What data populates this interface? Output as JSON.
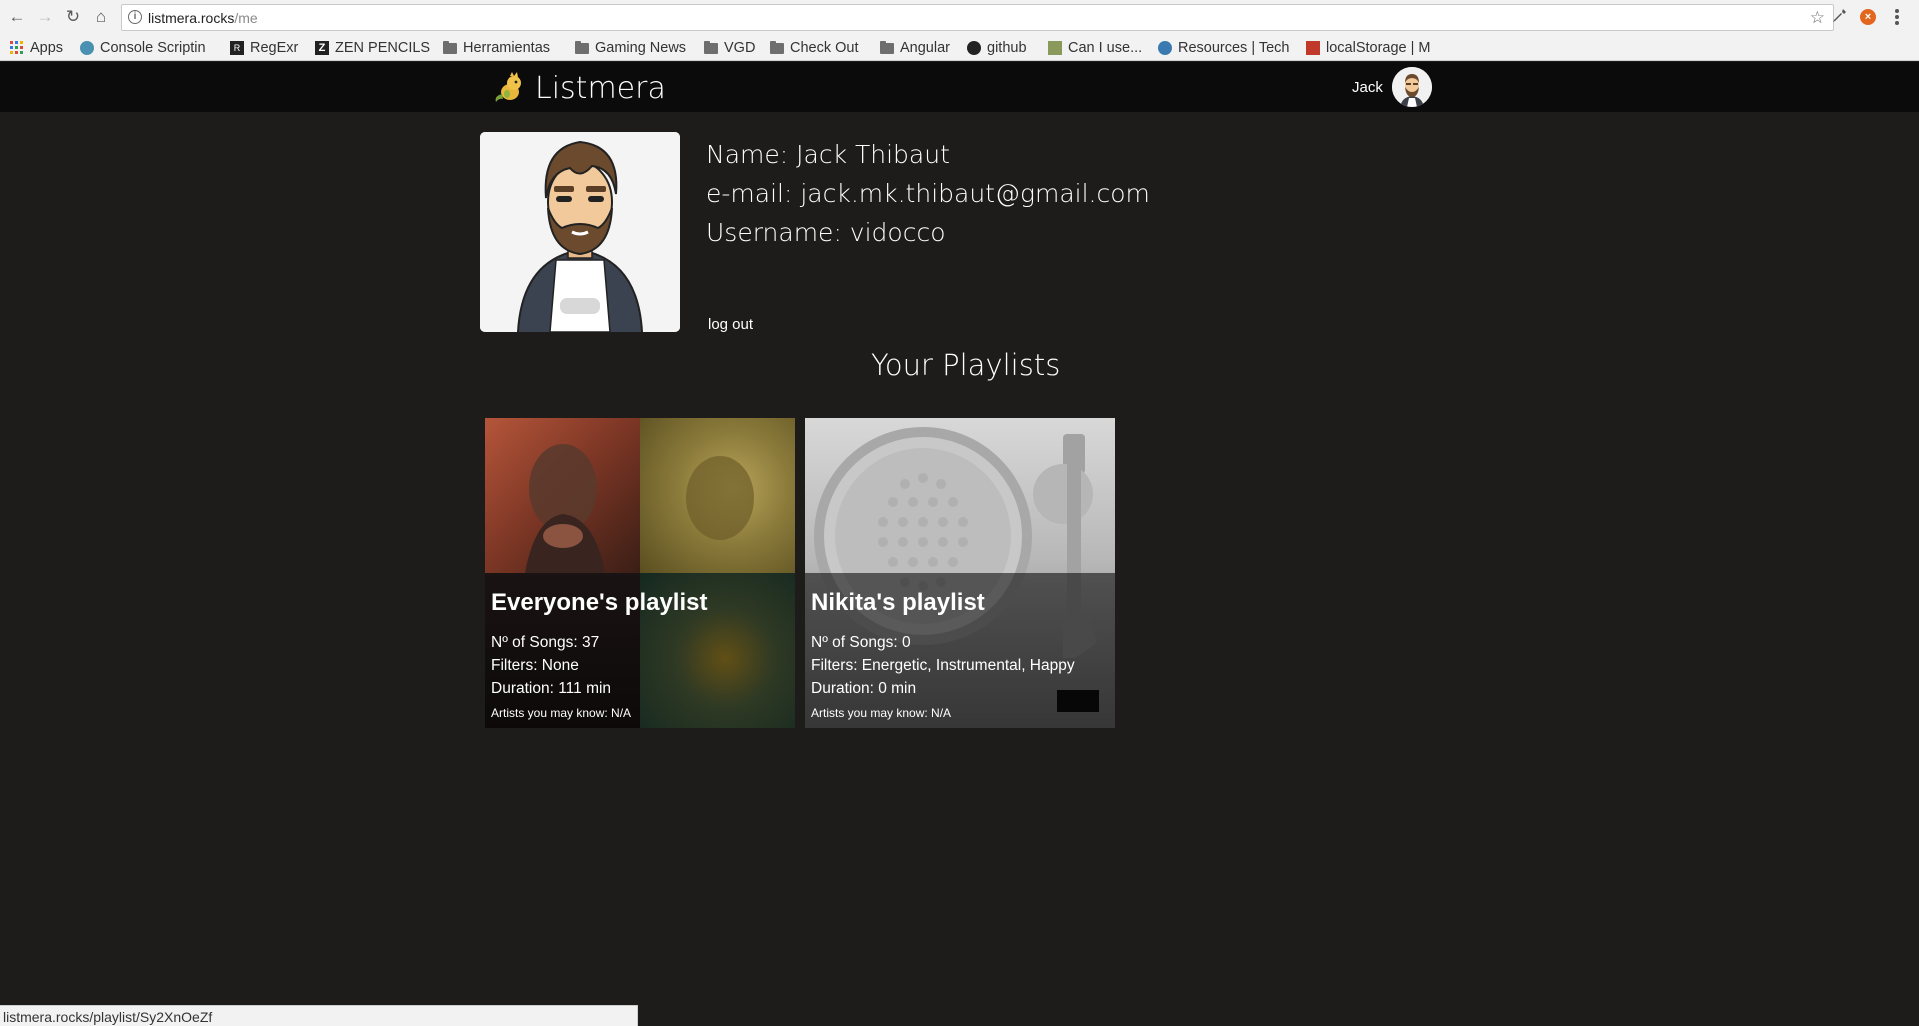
{
  "browser": {
    "url_host": "listmera.rocks",
    "url_path": "/me",
    "bookmarks": [
      {
        "label": "Apps",
        "icon": "apps-grid-icon"
      },
      {
        "label": "Console Scriptin",
        "icon": "globe-icon"
      },
      {
        "label": "RegExr",
        "icon": "regexr-icon"
      },
      {
        "label": "ZEN PENCILS",
        "icon": "zen-pencils-icon"
      },
      {
        "label": "Herramientas",
        "icon": "folder-icon"
      },
      {
        "label": "Gaming News",
        "icon": "folder-icon"
      },
      {
        "label": "VGD",
        "icon": "folder-icon"
      },
      {
        "label": "Check Out",
        "icon": "folder-icon"
      },
      {
        "label": "Angular",
        "icon": "folder-icon"
      },
      {
        "label": "github",
        "icon": "github-icon"
      },
      {
        "label": "Can I use...",
        "icon": "caniuse-icon"
      },
      {
        "label": "Resources | Tech",
        "icon": "resources-icon"
      },
      {
        "label": "localStorage | M",
        "icon": "mdn-icon"
      }
    ],
    "status_url": "listmera.rocks/playlist/Sy2XnOeZf"
  },
  "app": {
    "brand": "Listmera",
    "user_short_name": "Jack"
  },
  "profile": {
    "name_line": "Name: Jack Thibaut",
    "email_line": "e-mail: jack.mk.thibaut@gmail.com",
    "username_line": "Username: vidocco",
    "logout_label": "log out"
  },
  "playlists_title": "Your Playlists",
  "playlists": [
    {
      "title": "Everyone's playlist",
      "songs": "Nº of Songs: 37",
      "filters": "Filters: None",
      "duration": "Duration: 111 min",
      "artists": "Artists you may know: N/A"
    },
    {
      "title": "Nikita's playlist",
      "songs": "Nº of Songs: 0",
      "filters": "Filters: Energetic, Instrumental, Happy",
      "duration": "Duration: 0 min",
      "artists": "Artists you may know: N/A"
    }
  ],
  "colors": {
    "page_bg": "#1d1c1b",
    "appbar_bg": "#0b0b0b",
    "text": "#ffffff"
  }
}
